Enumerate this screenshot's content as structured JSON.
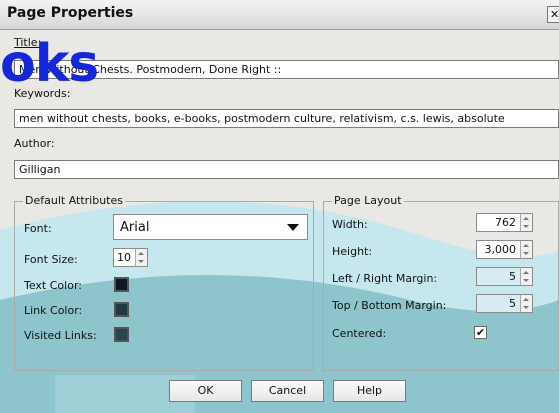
{
  "window": {
    "title": "Page Properties",
    "close_glyph": "✕"
  },
  "logo": {
    "text": "oks",
    "color": "#1428d8"
  },
  "fields": {
    "title_label": "Title:",
    "title_value": "Men Without Chests. Postmodern, Done Right ::",
    "keywords_label": "Keywords:",
    "keywords_value": "men without chests, books, e-books, postmodern culture, relativism, c.s. lewis, absolute",
    "author_label": "Author:",
    "author_value": "Gilligan"
  },
  "default_attributes": {
    "title": "Default Attributes",
    "font_label": "Font:",
    "font_value": "Arial",
    "font_size_label": "Font Size:",
    "font_size_value": "10",
    "text_color_label": "Text Color:",
    "link_color_label": "Link Color:",
    "visited_links_label": "Visited Links:",
    "colors": {
      "text": "#0d1820",
      "link": "#1f3a40",
      "visited": "#2b4648"
    }
  },
  "page_layout": {
    "title": "Page Layout",
    "width_label": "Width:",
    "width_value": "762",
    "height_label": "Height:",
    "height_value": "3,000",
    "lr_margin_label": "Left / Right Margin:",
    "lr_margin_value": "5",
    "tb_margin_label": "Top / Bottom Margin:",
    "tb_margin_value": "5",
    "centered_label": "Centered:",
    "centered_glyph": "✔"
  },
  "buttons": {
    "ok": "OK",
    "cancel": "Cancel",
    "help": "Help"
  },
  "theme": {
    "accent_band": "#c6e7ee"
  }
}
